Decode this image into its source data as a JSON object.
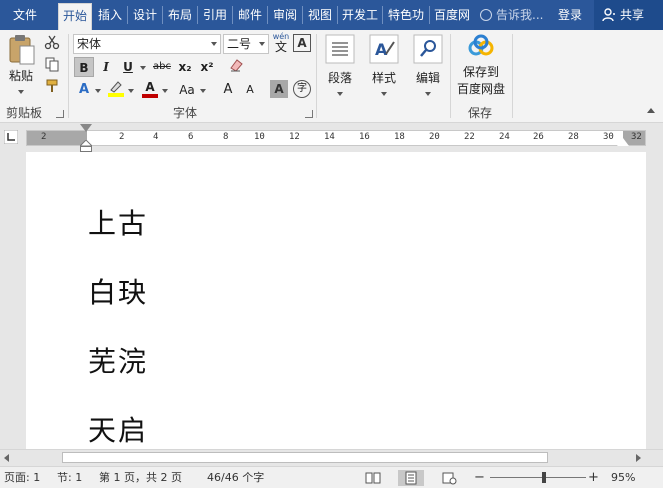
{
  "tabs": [
    {
      "label": "文件",
      "active": false
    },
    {
      "label": "开始",
      "active": true
    },
    {
      "label": "插入",
      "active": false
    },
    {
      "label": "设计",
      "active": false
    },
    {
      "label": "布局",
      "active": false
    },
    {
      "label": "引用",
      "active": false
    },
    {
      "label": "邮件",
      "active": false
    },
    {
      "label": "审阅",
      "active": false
    },
    {
      "label": "视图",
      "active": false
    },
    {
      "label": "开发工",
      "active": false
    },
    {
      "label": "特色功",
      "active": false
    },
    {
      "label": "百度网",
      "active": false
    }
  ],
  "tell_me": "告诉我...",
  "login": "登录",
  "share": "共享",
  "ribbon": {
    "clipboard": {
      "paste": "粘贴",
      "label": "剪贴板"
    },
    "font": {
      "font_name": "宋体",
      "font_size": "二号",
      "wen": "wén",
      "wen_char": "文",
      "boxed_a": "A",
      "bold": "B",
      "italic": "I",
      "underline": "U",
      "strike": "abc",
      "subscript": "x₂",
      "superscript": "x²",
      "text_effect": "A",
      "font_color": "A",
      "change_case": "Aa",
      "grow": "A",
      "shrink": "A",
      "shade": "A",
      "enclose": "字",
      "label": "字体"
    },
    "paragraph": {
      "label": "段落"
    },
    "styles": {
      "label": "样式"
    },
    "editing": {
      "label": "编辑"
    },
    "save": {
      "line1": "保存到",
      "line2": "百度网盘",
      "label": "保存"
    }
  },
  "ruler": {
    "labels": [
      "2",
      "2",
      "4",
      "6",
      "8",
      "10",
      "12",
      "14",
      "16",
      "18",
      "20",
      "22",
      "24",
      "26",
      "28",
      "30",
      "32"
    ]
  },
  "document": {
    "lines": [
      "上古",
      "白玦",
      "芜浣",
      "天启"
    ]
  },
  "status": {
    "page": "页面: 1",
    "section": "节: 1",
    "page_of": "第 1 页，共 2 页",
    "words": "46/46 个字",
    "zoom": "95%",
    "minus": "−",
    "plus": "+"
  },
  "colors": {
    "accent": "#2b579a",
    "font_color_bar": "#c00000",
    "highlight_bar": "#ffff00"
  }
}
